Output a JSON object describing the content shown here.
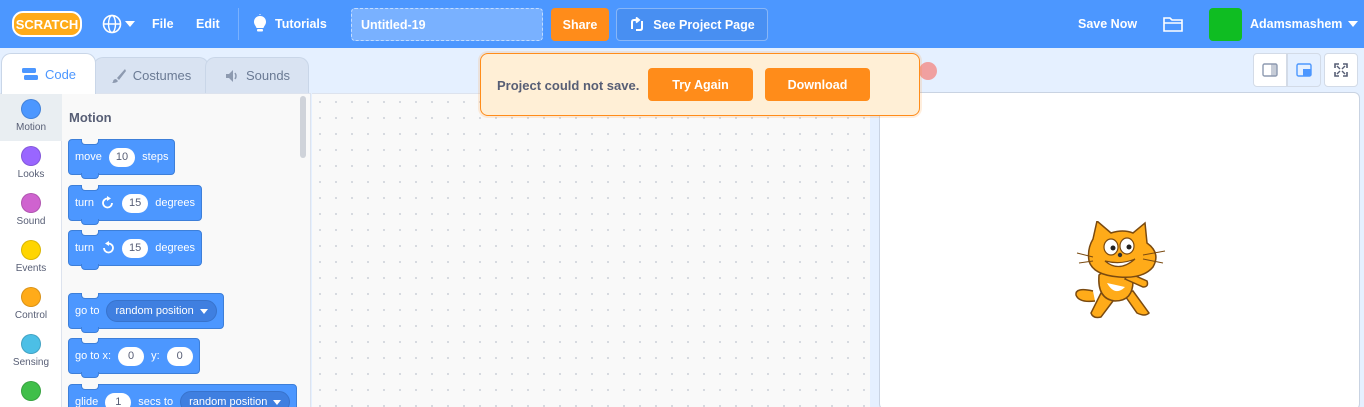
{
  "menubar": {
    "logo_text": "SCRATCH",
    "file_label": "File",
    "edit_label": "Edit",
    "tutorials_label": "Tutorials",
    "project_title": "Untitled-19",
    "share_label": "Share",
    "project_page_label": "See Project Page",
    "save_now_label": "Save Now",
    "username": "Adamsmashem",
    "menubar_color": "#4c97ff",
    "share_color": "#ff8c1a"
  },
  "tabs": {
    "code": "Code",
    "costumes": "Costumes",
    "sounds": "Sounds"
  },
  "categories": [
    {
      "label": "Motion",
      "color": "#4c97ff"
    },
    {
      "label": "Looks",
      "color": "#9966ff"
    },
    {
      "label": "Sound",
      "color": "#cf63cf"
    },
    {
      "label": "Events",
      "color": "#ffd500"
    },
    {
      "label": "Control",
      "color": "#ffab19"
    },
    {
      "label": "Sensing",
      "color": "#4cbfe6"
    },
    {
      "label": "",
      "color": "#40bf4a"
    }
  ],
  "palette": {
    "title": "Motion",
    "blocks": {
      "move": {
        "pre": "move",
        "value": "10",
        "post": "steps"
      },
      "turn_right": {
        "pre": "turn",
        "value": "15",
        "post": "degrees"
      },
      "turn_left": {
        "pre": "turn",
        "value": "15",
        "post": "degrees"
      },
      "goto": {
        "pre": "go to",
        "option": "random position"
      },
      "goto_xy": {
        "pre": "go to x:",
        "x": "0",
        "mid": "y:",
        "y": "0"
      },
      "glide": {
        "pre": "glide",
        "value": "1",
        "mid": "secs to",
        "option": "random position"
      }
    }
  },
  "alert": {
    "message": "Project could not save.",
    "retry_label": "Try Again",
    "download_label": "Download"
  }
}
